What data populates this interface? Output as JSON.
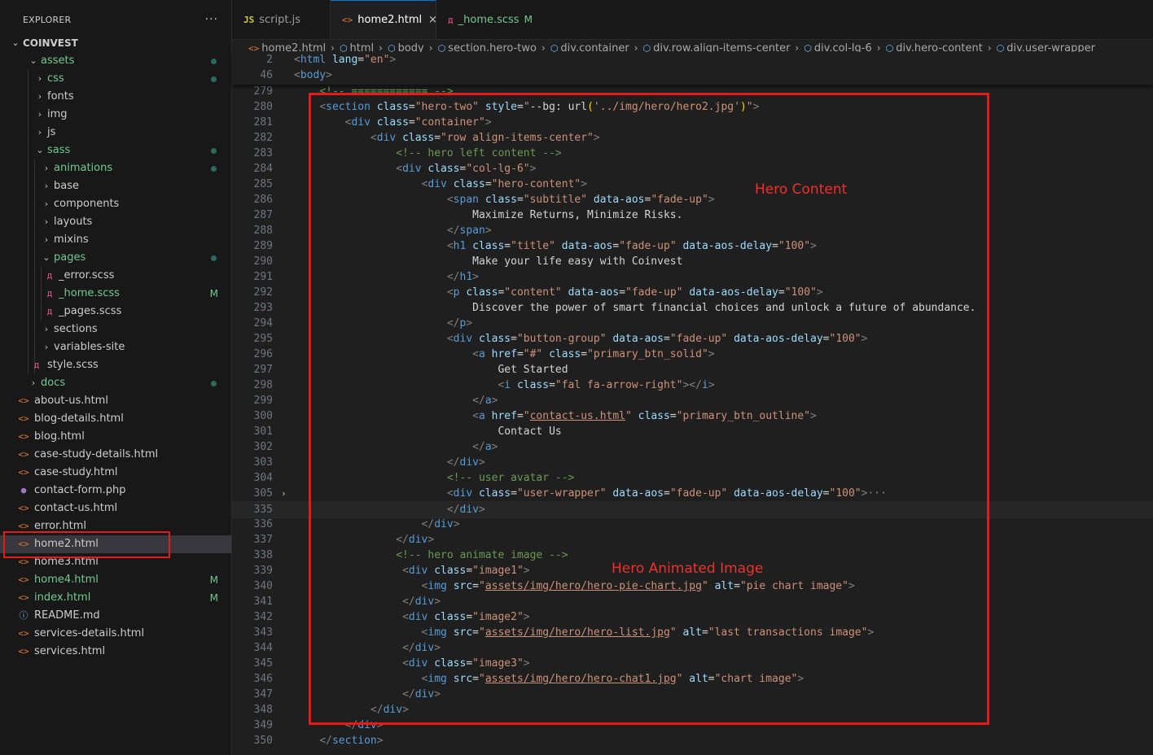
{
  "explorer": {
    "title": "EXPLORER",
    "more": "···",
    "project": "COINVEST",
    "items": [
      {
        "label": "assets",
        "depth": 1,
        "type": "folder-open",
        "git": true,
        "dot": true
      },
      {
        "label": "css",
        "depth": 2,
        "type": "folder",
        "git": true,
        "dot": true
      },
      {
        "label": "fonts",
        "depth": 2,
        "type": "folder"
      },
      {
        "label": "img",
        "depth": 2,
        "type": "folder"
      },
      {
        "label": "js",
        "depth": 2,
        "type": "folder"
      },
      {
        "label": "sass",
        "depth": 2,
        "type": "folder-open",
        "git": true,
        "dot": true
      },
      {
        "label": "animations",
        "depth": 3,
        "type": "folder",
        "git": true,
        "dot": true
      },
      {
        "label": "base",
        "depth": 3,
        "type": "folder"
      },
      {
        "label": "components",
        "depth": 3,
        "type": "folder"
      },
      {
        "label": "layouts",
        "depth": 3,
        "type": "folder"
      },
      {
        "label": "mixins",
        "depth": 3,
        "type": "folder"
      },
      {
        "label": "pages",
        "depth": 3,
        "type": "folder-open",
        "git": true,
        "dot": true
      },
      {
        "label": "_error.scss",
        "depth": 4,
        "type": "scss"
      },
      {
        "label": "_home.scss",
        "depth": 4,
        "type": "scss",
        "git": true,
        "mod": "M"
      },
      {
        "label": "_pages.scss",
        "depth": 4,
        "type": "scss"
      },
      {
        "label": "sections",
        "depth": 3,
        "type": "folder"
      },
      {
        "label": "variables-site",
        "depth": 3,
        "type": "folder"
      },
      {
        "label": "style.scss",
        "depth": 3,
        "type": "scss-file"
      },
      {
        "label": "docs",
        "depth": 1,
        "type": "folder",
        "git": true,
        "dot": true
      },
      {
        "label": "about-us.html",
        "depth": 1,
        "type": "html"
      },
      {
        "label": "blog-details.html",
        "depth": 1,
        "type": "html"
      },
      {
        "label": "blog.html",
        "depth": 1,
        "type": "html"
      },
      {
        "label": "case-study-details.html",
        "depth": 1,
        "type": "html"
      },
      {
        "label": "case-study.html",
        "depth": 1,
        "type": "html"
      },
      {
        "label": "contact-form.php",
        "depth": 1,
        "type": "php"
      },
      {
        "label": "contact-us.html",
        "depth": 1,
        "type": "html"
      },
      {
        "label": "error.html",
        "depth": 1,
        "type": "html"
      },
      {
        "label": "home2.html",
        "depth": 1,
        "type": "html",
        "selected": true
      },
      {
        "label": "home3.html",
        "depth": 1,
        "type": "html"
      },
      {
        "label": "home4.html",
        "depth": 1,
        "type": "html",
        "git": true,
        "mod": "M"
      },
      {
        "label": "index.html",
        "depth": 1,
        "type": "html",
        "git": true,
        "mod": "M"
      },
      {
        "label": "README.md",
        "depth": 1,
        "type": "info"
      },
      {
        "label": "services-details.html",
        "depth": 1,
        "type": "html"
      },
      {
        "label": "services.html",
        "depth": 1,
        "type": "html"
      }
    ]
  },
  "tabs": [
    {
      "label": "script.js",
      "icon": "JS",
      "active": false
    },
    {
      "label": "home2.html",
      "icon": "<>",
      "active": true,
      "close": "×"
    },
    {
      "label": "_home.scss",
      "icon": "scss",
      "active": false,
      "mod": "M"
    }
  ],
  "breadcrumbs": [
    "home2.html",
    "html",
    "body",
    "section.hero-two",
    "div.container",
    "div.row.align-items-center",
    "div.col-lg-6",
    "div.hero-content",
    "div.user-wrapper"
  ],
  "sticky_lines": [
    {
      "n": "2",
      "code": "<html lang=\"en\">"
    },
    {
      "n": "46",
      "code": "<body>"
    }
  ],
  "lines": [
    {
      "n": "279",
      "code": "    <!-- ============ -->"
    },
    {
      "n": "280",
      "code": "    <section class=\"hero-two\" style=\"--bg: url('../img/hero/hero2.jpg')\">"
    },
    {
      "n": "281",
      "code": "        <div class=\"container\">"
    },
    {
      "n": "282",
      "code": "            <div class=\"row align-items-center\">"
    },
    {
      "n": "283",
      "code": "                <!-- hero left content -->"
    },
    {
      "n": "284",
      "code": "                <div class=\"col-lg-6\">"
    },
    {
      "n": "285",
      "code": "                    <div class=\"hero-content\">"
    },
    {
      "n": "286",
      "code": "                        <span class=\"subtitle\" data-aos=\"fade-up\">"
    },
    {
      "n": "287",
      "code": "                            Maximize Returns, Minimize Risks."
    },
    {
      "n": "288",
      "code": "                        </span>"
    },
    {
      "n": "289",
      "code": "                        <h1 class=\"title\" data-aos=\"fade-up\" data-aos-delay=\"100\">"
    },
    {
      "n": "290",
      "code": "                            Make your life easy with Coinvest"
    },
    {
      "n": "291",
      "code": "                        </h1>"
    },
    {
      "n": "292",
      "code": "                        <p class=\"content\" data-aos=\"fade-up\" data-aos-delay=\"100\">"
    },
    {
      "n": "293",
      "code": "                            Discover the power of smart financial choices and unlock a future of abundance."
    },
    {
      "n": "294",
      "code": "                        </p>"
    },
    {
      "n": "295",
      "code": "                        <div class=\"button-group\" data-aos=\"fade-up\" data-aos-delay=\"100\">"
    },
    {
      "n": "296",
      "code": "                            <a href=\"#\" class=\"primary_btn_solid\">"
    },
    {
      "n": "297",
      "code": "                                Get Started"
    },
    {
      "n": "298",
      "code": "                                <i class=\"fal fa-arrow-right\"></i>"
    },
    {
      "n": "299",
      "code": "                            </a>"
    },
    {
      "n": "300",
      "code": "                            <a href=\"contact-us.html\" class=\"primary_btn_outline\">"
    },
    {
      "n": "301",
      "code": "                                Contact Us"
    },
    {
      "n": "302",
      "code": "                            </a>"
    },
    {
      "n": "303",
      "code": "                        </div>"
    },
    {
      "n": "304",
      "code": "                        <!-- user avatar -->"
    },
    {
      "n": "305",
      "code": "                        <div class=\"user-wrapper\" data-aos=\"fade-up\" data-aos-delay=\"100\">···"
    },
    {
      "n": "335",
      "code": "                        </div>"
    },
    {
      "n": "336",
      "code": "                    </div>"
    },
    {
      "n": "337",
      "code": "                </div>"
    },
    {
      "n": "338",
      "code": "                <!-- hero animate image -->"
    },
    {
      "n": "339",
      "code": "                 <div class=\"image1\">"
    },
    {
      "n": "340",
      "code": "                    <img src=\"assets/img/hero/hero-pie-chart.jpg\" alt=\"pie chart image\">"
    },
    {
      "n": "341",
      "code": "                 </div>"
    },
    {
      "n": "342",
      "code": "                 <div class=\"image2\">"
    },
    {
      "n": "343",
      "code": "                    <img src=\"assets/img/hero/hero-list.jpg\" alt=\"last transactions image\">"
    },
    {
      "n": "344",
      "code": "                 </div>"
    },
    {
      "n": "345",
      "code": "                 <div class=\"image3\">"
    },
    {
      "n": "346",
      "code": "                    <img src=\"assets/img/hero/hero-chat1.jpg\" alt=\"chart image\">"
    },
    {
      "n": "347",
      "code": "                 </div>"
    },
    {
      "n": "348",
      "code": "            </div>"
    },
    {
      "n": "349",
      "code": "        </div>"
    },
    {
      "n": "350",
      "code": "    </section>"
    }
  ],
  "annotations": {
    "hero_content": "Hero Content",
    "hero_image": "Hero Animated Image"
  },
  "colors": {
    "highlight": "#e51b1b",
    "annotation": "#f0302a",
    "git_modified": "#73c991"
  }
}
